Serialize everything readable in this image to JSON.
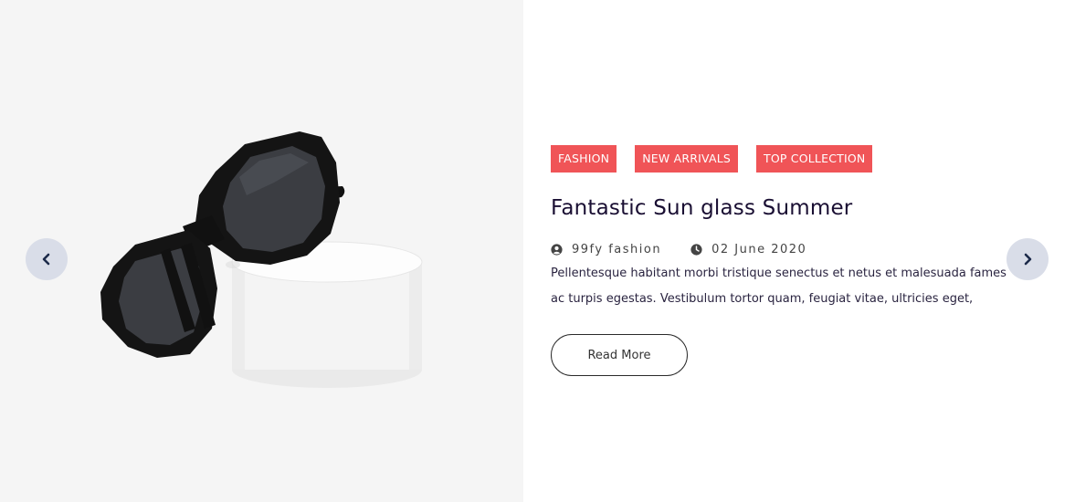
{
  "slide": {
    "tags": [
      "FASHION",
      "NEW ARRIVALS",
      "TOP COLLECTION"
    ],
    "title": "Fantastic Sun glass Summer",
    "author": "99fy fashion",
    "date": "02 June 2020",
    "excerpt": "Pellentesque habitant morbi tristique senectus et netus et malesuada fames ac turpis egestas. Vestibulum tortor quam, feugiat vitae, ultricies eget,",
    "read_more_label": "Read More",
    "author_icon": "user-circle-icon",
    "date_icon": "clock-icon"
  },
  "navigation": {
    "prev_icon": "chevron-left-icon",
    "next_icon": "chevron-right-icon"
  },
  "colors": {
    "tag_background": "#f05457",
    "title": "#1a0f33",
    "image_panel": "#f5f5f5",
    "nav_button": "#d9dde8",
    "nav_arrow": "#1c2a4a"
  }
}
